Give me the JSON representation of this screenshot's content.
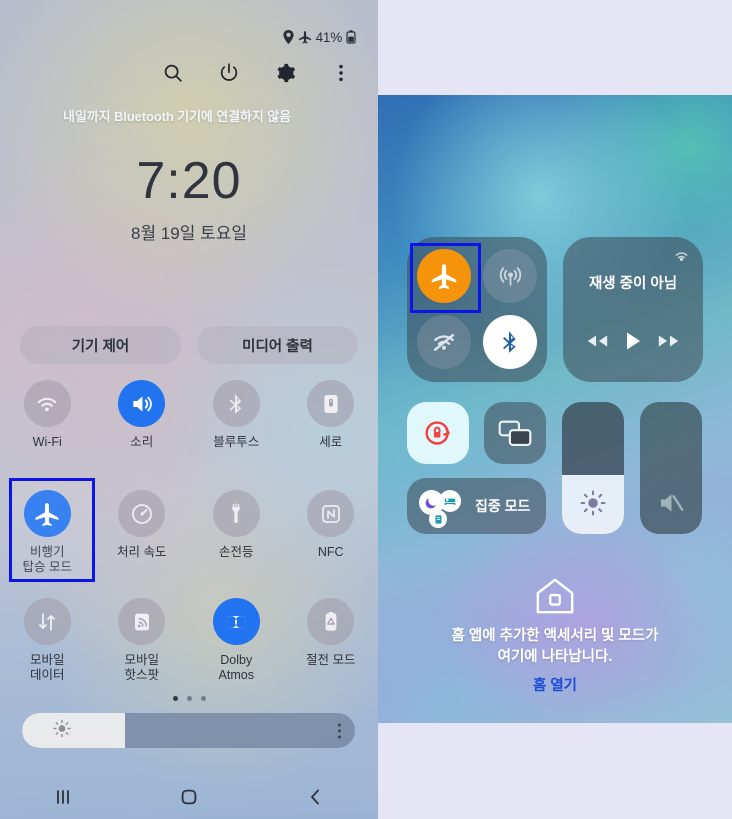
{
  "samsung": {
    "status_bar": {
      "location_icon": "location-pin-icon",
      "airplane_icon": "airplane-icon",
      "battery_percent": "41%",
      "battery_icon": "battery-icon"
    },
    "header_icons": [
      {
        "name": "search-icon",
        "label": "검색"
      },
      {
        "name": "power-icon",
        "label": "전원"
      },
      {
        "name": "settings-gear-icon",
        "label": "설정"
      },
      {
        "name": "more-options-icon",
        "label": "더보기"
      }
    ],
    "clock": {
      "time": "7:20",
      "date": "8월 19일 토요일"
    },
    "pills": [
      {
        "label": "기기 제어"
      },
      {
        "label": "미디어 출력"
      }
    ],
    "toggles_row1": [
      {
        "label": "Wi-Fi",
        "icon": "wifi-icon",
        "state": "off"
      },
      {
        "label": "소리",
        "icon": "sound-icon",
        "state": "on"
      },
      {
        "label": "블루투스",
        "icon": "bluetooth-icon",
        "state": "off"
      },
      {
        "label": "세로",
        "icon": "rotation-lock-icon",
        "state": "off"
      }
    ],
    "toggles_row2": [
      {
        "label": "비행기\n탑승 모드",
        "icon": "airplane-icon",
        "state": "on",
        "highlighted": true
      },
      {
        "label": "처리 속도",
        "icon": "speedometer-icon",
        "state": "off"
      },
      {
        "label": "손전등",
        "icon": "flashlight-icon",
        "state": "off"
      },
      {
        "label": "NFC",
        "icon": "nfc-icon",
        "state": "off"
      }
    ],
    "toggles_row3": [
      {
        "label": "모바일\n데이터",
        "icon": "mobile-data-icon",
        "state": "off"
      },
      {
        "label": "모바일\n핫스팟",
        "icon": "hotspot-icon",
        "state": "off"
      },
      {
        "label": "Dolby\nAtmos",
        "icon": "dolby-atmos-icon",
        "state": "on"
      },
      {
        "label": "절전 모드",
        "icon": "power-saving-icon",
        "state": "off"
      }
    ],
    "page_dots": {
      "total": 3,
      "active_index": 0
    },
    "brightness": {
      "icon": "brightness-sun-icon",
      "value_percent": 31,
      "more_icon": "more-options-icon"
    },
    "navbar": [
      {
        "name": "recents-button",
        "icon": "recents-icon"
      },
      {
        "name": "home-button",
        "icon": "home-square-icon"
      },
      {
        "name": "back-button",
        "icon": "back-chevron-icon"
      }
    ],
    "highlight_color": "#0b15e8"
  },
  "ios": {
    "banner": "내일까지 Bluetooth 기기에 연결하지 않음",
    "connectivity": [
      {
        "name": "airplane-mode-toggle",
        "icon": "airplane-icon",
        "state": "on",
        "color": "#f5930a",
        "highlighted": true
      },
      {
        "name": "cellular-toggle",
        "icon": "cellular-antenna-icon",
        "state": "off"
      },
      {
        "name": "wifi-toggle",
        "icon": "wifi-off-icon",
        "state": "off"
      },
      {
        "name": "bluetooth-toggle",
        "icon": "bluetooth-icon",
        "state": "on"
      }
    ],
    "media": {
      "title": "재생 중이 아님",
      "airplay_icon": "airplay-icon",
      "controls": [
        {
          "name": "rewind-button",
          "icon": "rewind-icon"
        },
        {
          "name": "play-button",
          "icon": "play-icon"
        },
        {
          "name": "forward-button",
          "icon": "fast-forward-icon"
        }
      ]
    },
    "rotation_lock": {
      "name": "rotation-lock-toggle",
      "icon": "rotation-lock-icon",
      "state": "on"
    },
    "screen_mirroring": {
      "name": "screen-mirroring-button",
      "icon": "screen-mirroring-icon"
    },
    "focus": {
      "label": "집중 모드",
      "icons": [
        "moon-icon",
        "bed-icon",
        "book-icon"
      ]
    },
    "brightness_slider": {
      "name": "brightness-slider",
      "icon": "brightness-sun-icon",
      "value_percent": 45
    },
    "volume_slider": {
      "name": "volume-slider",
      "icon": "volume-mute-icon",
      "value_percent": 0
    },
    "home": {
      "icon": "home-house-icon",
      "text": "홈 앱에 추가한 액세서리 및 모드가\n여기에 나타납니다.",
      "link": "홈 열기",
      "link_color": "#1c4bd8"
    },
    "highlight_color": "#0b15e8"
  }
}
